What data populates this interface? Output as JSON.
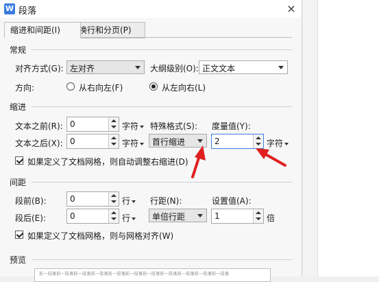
{
  "dialog": {
    "title": "段落",
    "app_icon_letter": "W",
    "close_symbol": "×"
  },
  "tabs": [
    {
      "label": "缩进和间距(I)",
      "active": true
    },
    {
      "label": "换行和分页(P)",
      "active": false
    }
  ],
  "general": {
    "section_title": "常规",
    "alignment_label": "对齐方式(G):",
    "alignment_value": "左对齐",
    "outline_label": "大纲级别(O):",
    "outline_value": "正文文本",
    "direction_label": "方向:",
    "direction_rtl": "从右向左(F)",
    "direction_ltr": "从左向右(L)",
    "direction_selected": "ltr"
  },
  "indent": {
    "section_title": "缩进",
    "before_label": "文本之前(R):",
    "before_value": "0",
    "before_unit": "字符",
    "after_label": "文本之后(X):",
    "after_value": "0",
    "after_unit": "字符",
    "special_label": "特殊格式(S):",
    "special_value": "首行缩进",
    "measure_label": "度量值(Y):",
    "measure_value": "2",
    "measure_unit": "字符",
    "auto_adjust_label": "如果定义了文档网格，则自动调整右缩进(D)",
    "auto_adjust_checked": true
  },
  "spacing": {
    "section_title": "间距",
    "before_label": "段前(B):",
    "before_value": "0",
    "before_unit": "行",
    "after_label": "段后(E):",
    "after_value": "0",
    "after_unit": "行",
    "line_label": "行距(N):",
    "line_value": "单倍行距",
    "setting_label": "设置值(A):",
    "setting_value": "1",
    "setting_unit": "倍",
    "snap_grid_label": "如果定义了文档网格，则与网格对齐(W)",
    "snap_grid_checked": true
  },
  "preview": {
    "section_title": "预览",
    "sample_text": "前一段落前一段落前一段落前一段落前一段落前一段落前一段落前一段落前一段落前一段落前一段落"
  },
  "colors": {
    "accent": "#3b7ddd",
    "arrow": "#e02020"
  }
}
